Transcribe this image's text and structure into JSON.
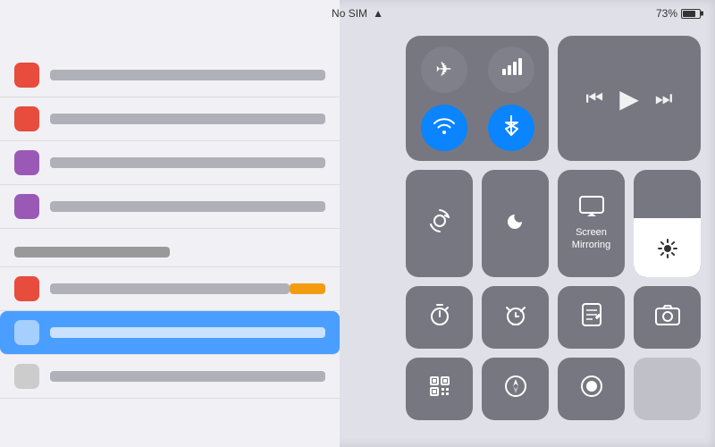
{
  "statusBar": {
    "carrier": "No SIM",
    "batteryPercent": "73%",
    "wifiIcon": "wifi"
  },
  "connectivity": {
    "airplane": {
      "icon": "✈",
      "active": false
    },
    "cellular": {
      "icon": "📶",
      "active": false
    },
    "wifi": {
      "icon": "📶",
      "active": true
    },
    "bluetooth": {
      "icon": "✦",
      "active": true
    }
  },
  "media": {
    "rewind": "◀◀",
    "play": "▶",
    "fastforward": "▶▶"
  },
  "controls": {
    "rotationLock": "⊙",
    "doNotDisturb": "☽",
    "screenMirroringLabel": "Screen\nMirroring",
    "screenMirroringIcon": "⬜",
    "brightness": 55
  },
  "bottomRow1": {
    "timer": "⏱",
    "alarm": "⏰",
    "notes": "📝",
    "camera": "📷"
  },
  "bottomRow2": {
    "qr": "⬜",
    "compass": "✦",
    "record": "⏺",
    "extra": ""
  }
}
